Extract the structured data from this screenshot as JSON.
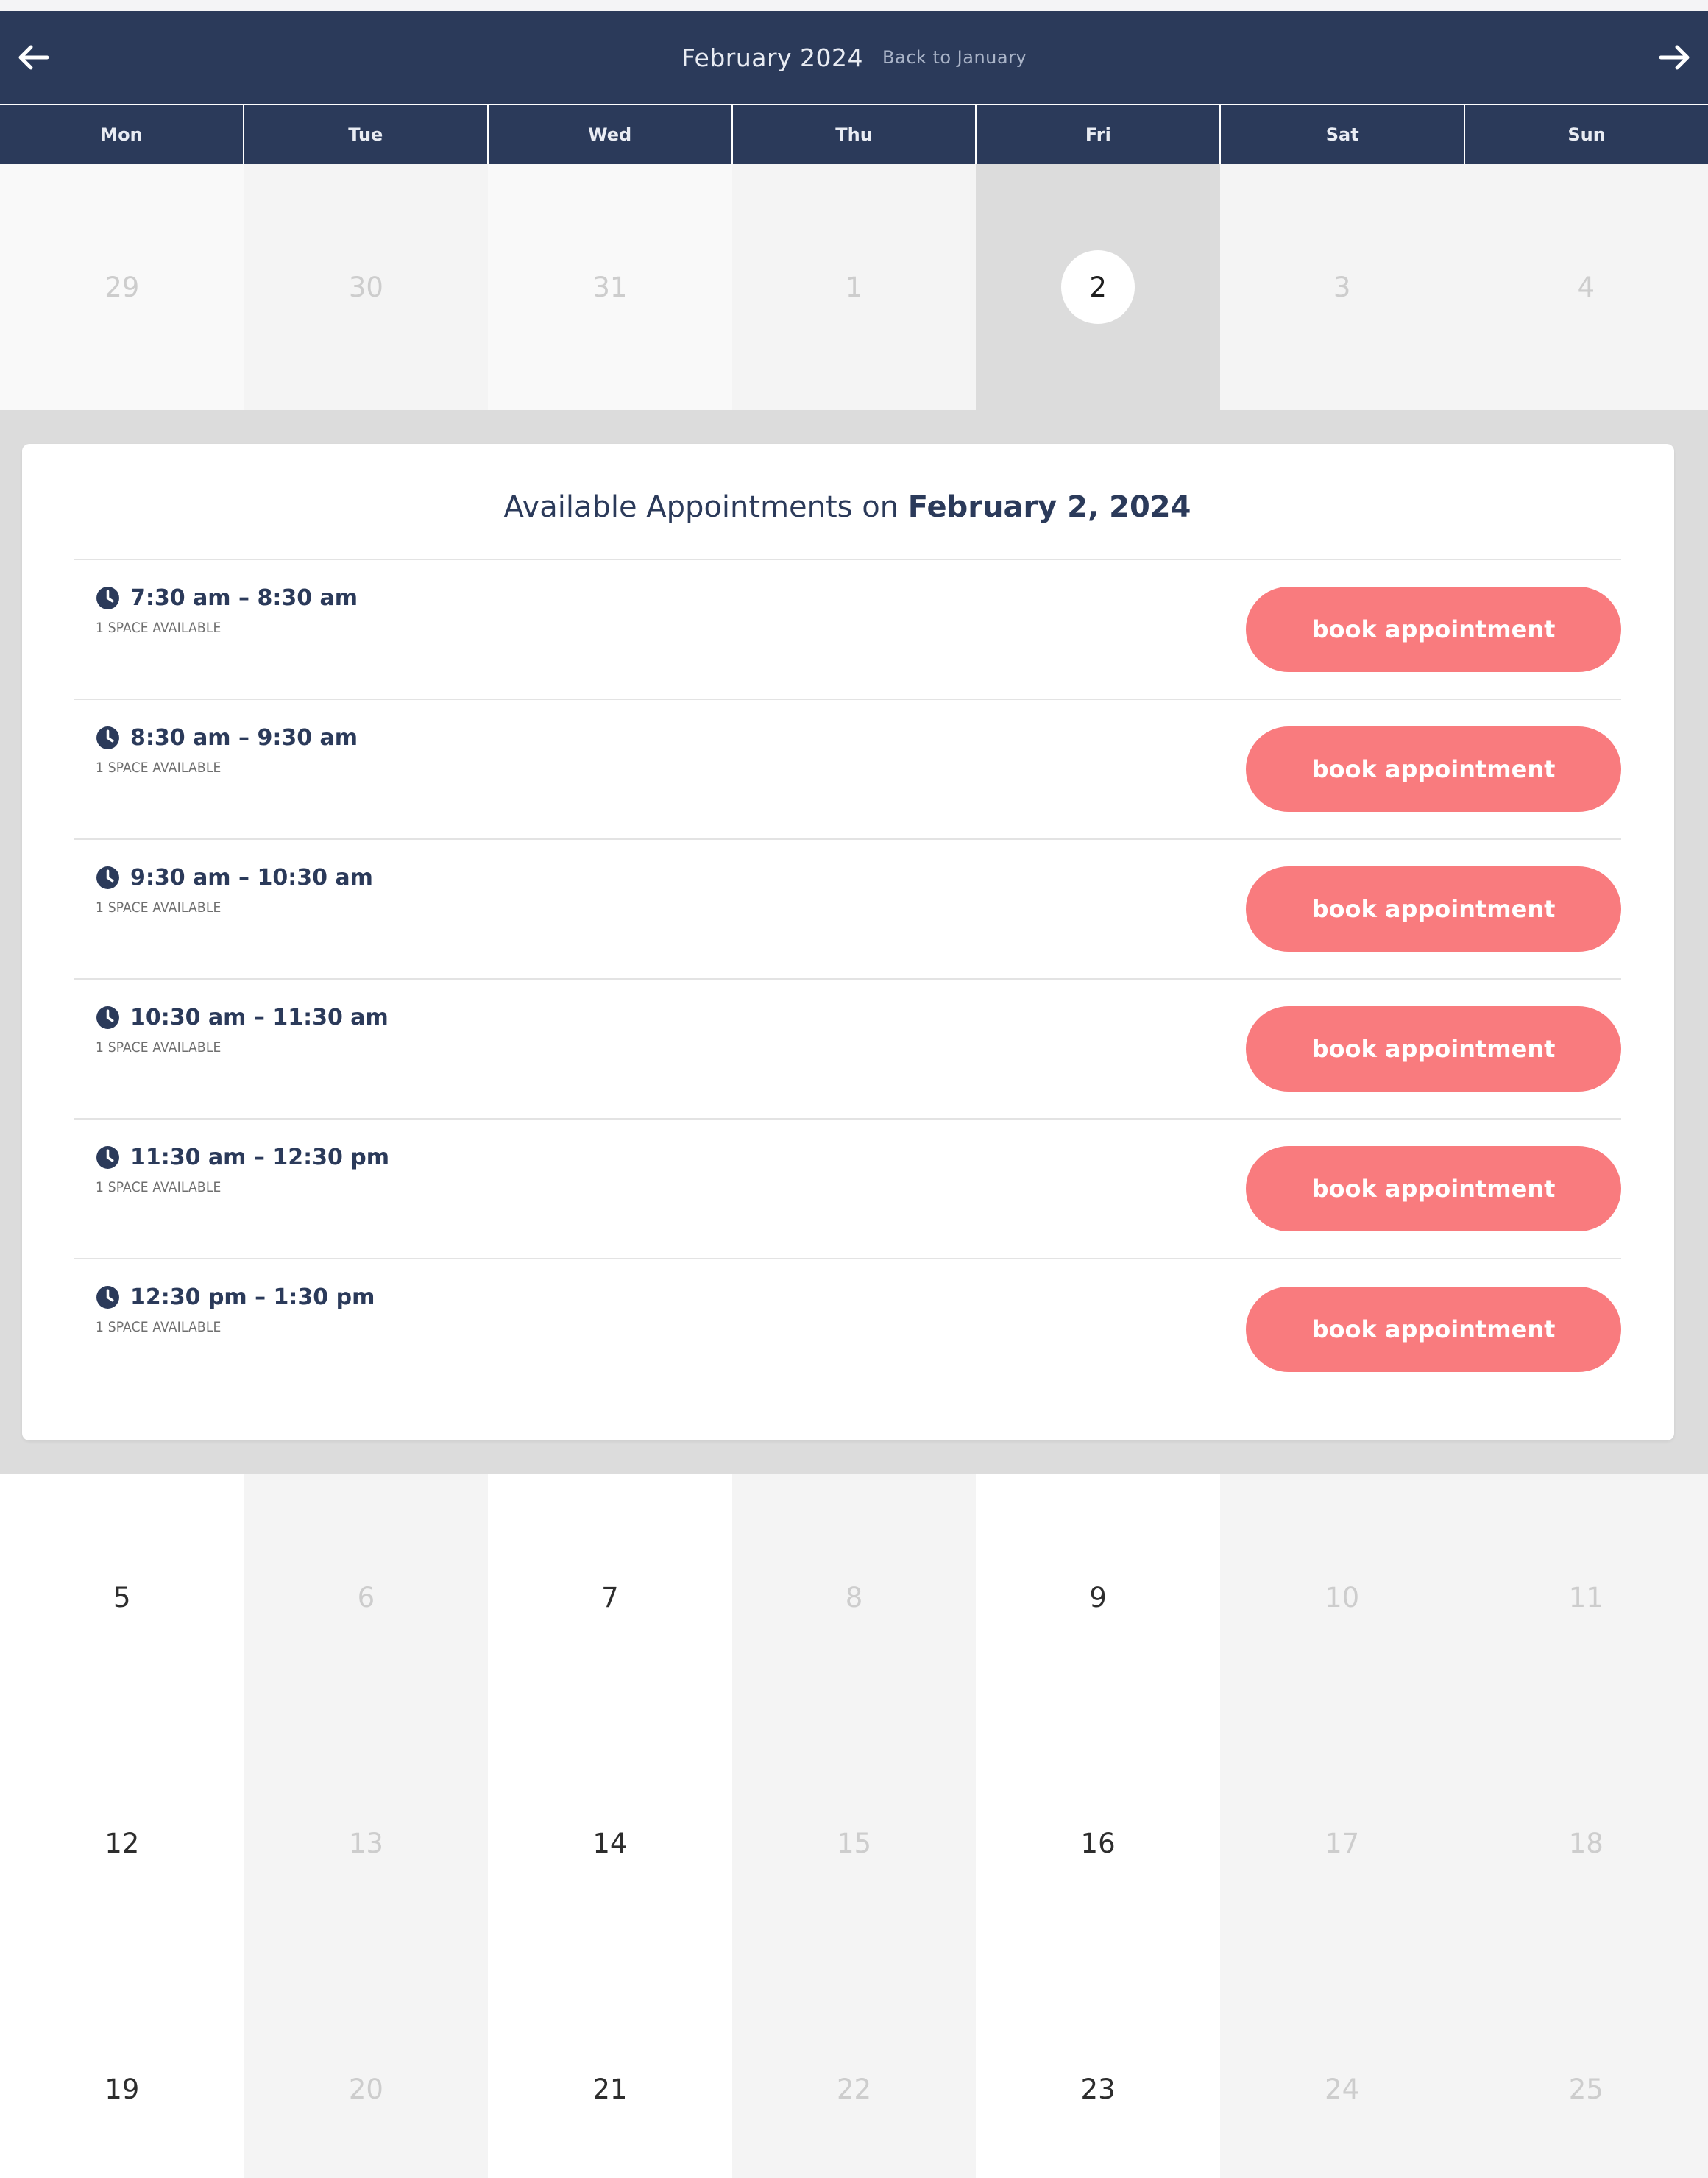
{
  "nav": {
    "month_title": "February 2024",
    "back_link": "Back to January"
  },
  "weekdays": [
    "Mon",
    "Tue",
    "Wed",
    "Thu",
    "Fri",
    "Sat",
    "Sun"
  ],
  "week1": [
    "29",
    "30",
    "31",
    "1",
    "2",
    "3",
    "4"
  ],
  "appointments": {
    "title_prefix": "Available Appointments on",
    "title_date": "February 2, 2024",
    "button_label": "book appointment",
    "slots": [
      {
        "time": "7:30 am – 8:30 am",
        "space": "1 SPACE AVAILABLE"
      },
      {
        "time": "8:30 am – 9:30 am",
        "space": "1 SPACE AVAILABLE"
      },
      {
        "time": "9:30 am – 10:30 am",
        "space": "1 SPACE AVAILABLE"
      },
      {
        "time": "10:30 am – 11:30 am",
        "space": "1 SPACE AVAILABLE"
      },
      {
        "time": "11:30 am – 12:30 pm",
        "space": "1 SPACE AVAILABLE"
      },
      {
        "time": "12:30 pm – 1:30 pm",
        "space": "1 SPACE AVAILABLE"
      }
    ]
  },
  "week2": [
    "5",
    "6",
    "7",
    "8",
    "9",
    "10",
    "11"
  ],
  "week3": [
    "12",
    "13",
    "14",
    "15",
    "16",
    "17",
    "18"
  ],
  "week4": [
    "19",
    "20",
    "21",
    "22",
    "23",
    "24",
    "25"
  ],
  "colors": {
    "navy": "#2b3a5a",
    "button": "#f97b7e",
    "selected_column": "#dcdcdc"
  }
}
